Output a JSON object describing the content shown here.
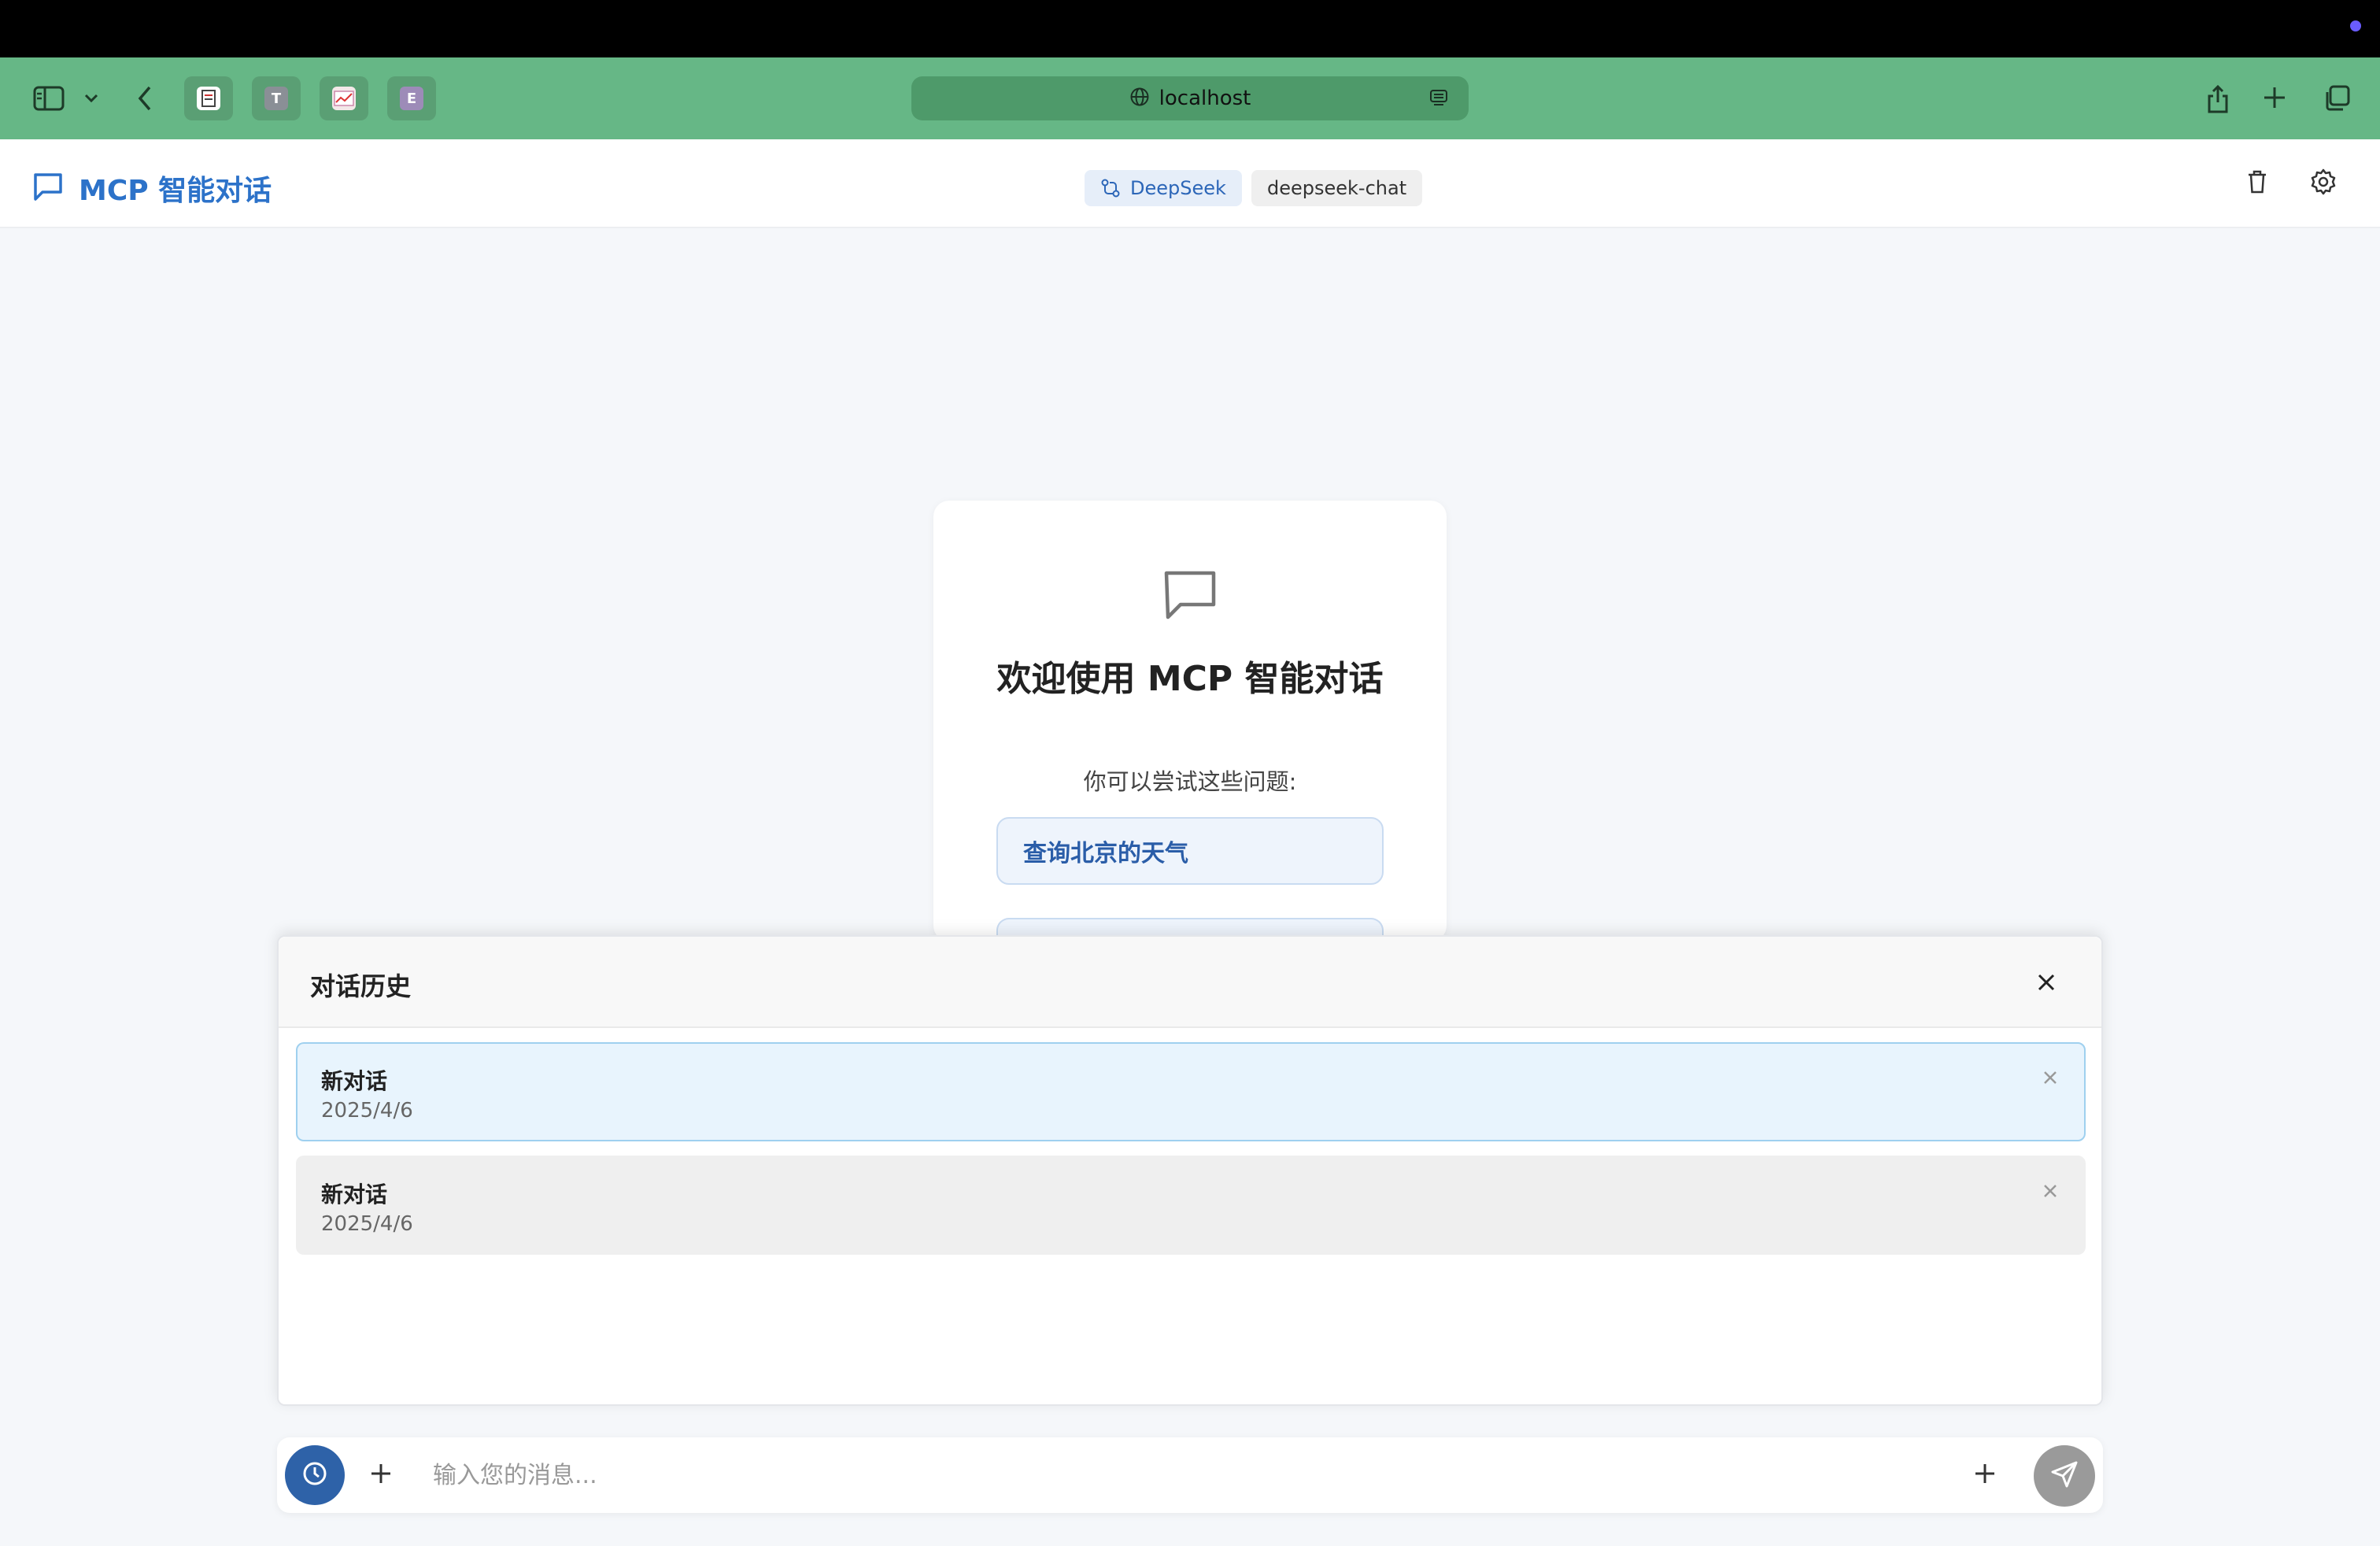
{
  "browser": {
    "address": "localhost",
    "tabs": [
      {
        "label": ""
      },
      {
        "label": "T"
      },
      {
        "label": ""
      },
      {
        "label": "E"
      }
    ]
  },
  "header": {
    "title": "MCP 智能对话",
    "provider": "DeepSeek",
    "model": "deepseek-chat"
  },
  "welcome": {
    "title": "欢迎使用 MCP 智能对话",
    "suggest_label": "你可以尝试这些问题:",
    "suggestions": [
      "查询北京的天气",
      ""
    ]
  },
  "history": {
    "title": "对话历史",
    "items": [
      {
        "title": "新对话",
        "date": "2025/4/6",
        "active": true
      },
      {
        "title": "新对话",
        "date": "2025/4/6",
        "active": false
      }
    ]
  },
  "input": {
    "placeholder": "输入您的消息..."
  },
  "colors": {
    "browser_toolbar": "#66b786",
    "accent": "#2c72c9",
    "history_button": "#2e62a8",
    "send_button": "#9a9a9a"
  }
}
